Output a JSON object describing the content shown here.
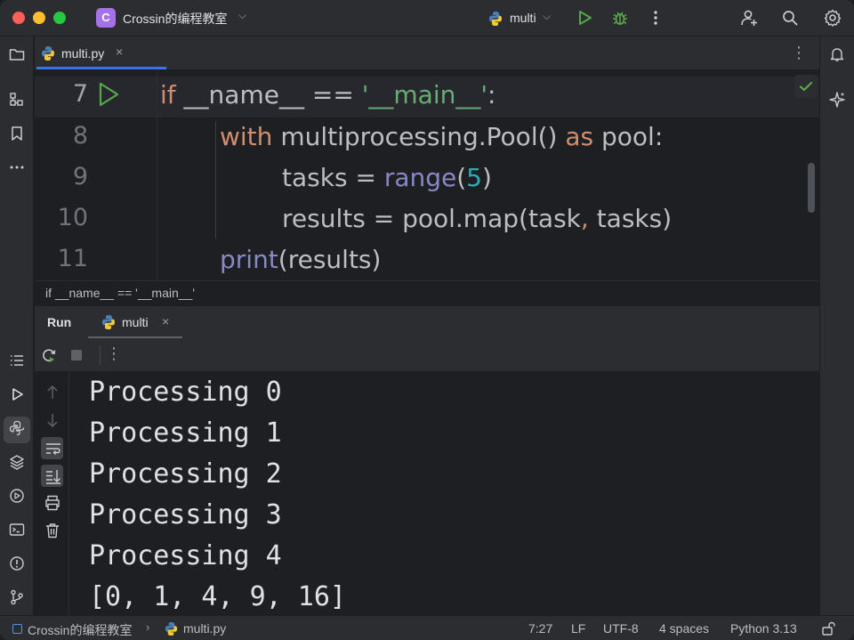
{
  "titlebar": {
    "project_badge": "C",
    "project_name": "Crossin的编程教室",
    "run_config": "multi",
    "icons": [
      "python-icon",
      "run-icon",
      "debug-icon",
      "more-icon",
      "add-user-icon",
      "search-icon",
      "settings-icon"
    ]
  },
  "editor_tab": {
    "label": "multi.py",
    "close": "×",
    "more": "⋮"
  },
  "editor": {
    "lines": [
      {
        "num": "7",
        "code": "if __name__ == '__main__':"
      },
      {
        "num": "8",
        "code": "with multiprocessing.Pool() as pool:"
      },
      {
        "num": "9",
        "code": "tasks = range(5)"
      },
      {
        "num": "10",
        "code": "results = pool.map(task, tasks)"
      },
      {
        "num": "11",
        "code": "print(results)"
      }
    ],
    "tokens": {
      "l7_if": "if",
      "l7_name": "__name__",
      "l7_eq": "==",
      "l7_main": "'__main__'",
      "l7_colon": ":",
      "l8_with": "with",
      "l8_mp": "multiprocessing.Pool()",
      "l8_as": "as",
      "l8_pool": "pool:",
      "l9_tasks": "tasks",
      "l9_eq": "=",
      "l9_range": "range",
      "l9_lp": "(",
      "l9_five": "5",
      "l9_rp": ")",
      "l10_results": "results",
      "l10_eq": "=",
      "l10_map": "pool.map(task",
      "l10_comma": ",",
      "l10_tasks": "tasks)",
      "l11_print": "print",
      "l11_arg": "(results)"
    }
  },
  "breadcrumb": "if __name__ == '__main__'",
  "run_panel": {
    "title": "Run",
    "tab_label": "multi",
    "tab_close": "×",
    "more": "⋮",
    "output": [
      "Processing 0",
      "Processing 1",
      "Processing 2",
      "Processing 3",
      "Processing 4",
      "[0, 1, 4, 9, 16]"
    ]
  },
  "statusbar": {
    "project": "Crossin的编程教室",
    "chevron": "›",
    "file": "multi.py",
    "position": "7:27",
    "line_sep": "LF",
    "encoding": "UTF-8",
    "indent": "4 spaces",
    "interpreter": "Python 3.13"
  }
}
